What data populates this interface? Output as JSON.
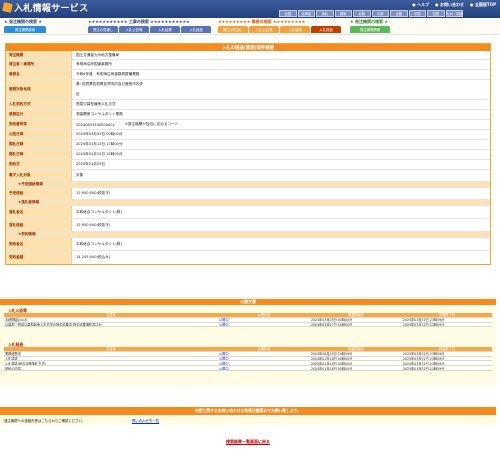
{
  "header": {
    "title": "入札情報サービス",
    "links": [
      "ヘルプ",
      "お問い合わせ",
      "全国版TOP"
    ],
    "regions": [
      "全国",
      "北海道",
      "東北",
      "関東",
      "北陸",
      "中部",
      "近畿",
      "中国",
      "四国",
      "九州・沖縄"
    ],
    "brand_color": "#2c4a8a",
    "accent_color": "#f58a1f"
  },
  "nav": {
    "groups": [
      {
        "head": "★ 発注機関の検索 ★",
        "head_color": "#2c4a8a",
        "tab_color": "#2c8fd6",
        "tabs": [
          "発注機関検索"
        ]
      },
      {
        "head": "★★★★★★★★★★★ 工事の検索 ★★★★★★★★★★★",
        "head_color": "#2c4a8a",
        "tab_color": "#5a73b8",
        "tabs": [
          "発注の見通し",
          "入札公告等",
          "入札結果",
          "入札経過"
        ]
      },
      {
        "head": "★★★★★★★★★ 業務の検索 ★★★★★★★★★",
        "head_color": "#e06000",
        "tab_color": "#f2a03c",
        "tabs": [
          "発注の見通し",
          "入札公告等",
          "入札結果",
          "入札経過"
        ]
      },
      {
        "head": "★ 発注機関の検索 ★",
        "head_color": "#2e8b2e",
        "tab_color": "#5cb85c",
        "tabs": [
          "発注機関情報"
        ]
      }
    ]
  },
  "main": {
    "title": "入札の経過(業務)案件概要",
    "rows": [
      {
        "label": "発注機関",
        "value": "国土交通省九州地方整備局"
      },
      {
        "label": "発注者・事務所",
        "value": "有明海沿岸国道事務所"
      },
      {
        "label": "業務名",
        "value": "令和6年度　有明海沿岸道路再整備業務"
      },
      {
        "label": "業務対象地域",
        "value": "県: 佐賀県佐賀県佐賀市内及び鹿島市内外",
        "value2": "区"
      },
      {
        "label": "入札契約方式",
        "value": "簡易公募型競争入札方式"
      },
      {
        "label": "業務区分",
        "value": "測量関係コンサルタント業務"
      },
      {
        "label": "契約番号等",
        "value": "20240801330200002",
        "note": "※発注機関が独自に定めるコード"
      },
      {
        "label": "公告日時",
        "value": "2024年03月05日 00時00分"
      },
      {
        "label": "開札日時",
        "value": "2024年01月15日 17時00分"
      },
      {
        "label": "開札日時",
        "value": "2024年01月15日 10時00分"
      },
      {
        "label": "契約日",
        "value": "2024年01月25日"
      },
      {
        "label": "電子入札対象",
        "value": "対象"
      }
    ],
    "sections": {
      "plan_title": "★予定価格情報",
      "winner_title": "★落札者情報",
      "contract_title": "★契約情報"
    },
    "planned_price": {
      "label": "予定価格",
      "value": "12,950,000(税抜き)"
    },
    "winner": [
      {
        "label": "落札者名",
        "value": "平和総合コンサルタント(株)"
      },
      {
        "label": "落札価格",
        "value": "12,950,000(税抜き)"
      }
    ],
    "contract": [
      {
        "label": "契約者名",
        "value": "平和総合コンサルタント(株)"
      },
      {
        "label": "契約金額",
        "value": "14,245,000(税込み)"
      }
    ]
  },
  "docs": {
    "title": "公開文書",
    "section1": {
      "title": "入札公告等",
      "headers": [
        "文書名",
        "公開状況",
        "掲載開始日",
        "掲載終了日"
      ],
      "rows": [
        [
          "手続開始の公示",
          "公開中",
          "2024年03月05日 00時00分",
          "2025年03月31日 23時59分"
        ],
        [
          "公募型・簡易公募型競争入札方式の指名結果書 指名結果通知書ほか",
          "公開中",
          "2024年03月27日 00時00分",
          "2025年03月31日 23時59分"
        ]
      ]
    },
    "section2": {
      "title": "入札経過",
      "headers": [
        "文書名",
        "公開状況",
        "掲載開始日",
        "掲載終了日"
      ],
      "rows": [
        [
          "業務経歴書",
          "公開中",
          "2024年06月25日 19時59分",
          "2025年03月31日 23時59分"
        ],
        [
          "入札調書",
          "公開中",
          "2024年01月18日 00時00分",
          "2025年03月31日 23時59分"
        ],
        [
          "入札調書(総合評価落札方式)",
          "公開中",
          "2024年01月18日 00時00分",
          "2025年03月31日 23時59分"
        ],
        [
          "契約の内容",
          "公開中",
          "2024年01月18日 00時00分",
          "2025年03月31日 23時59分"
        ]
      ]
    }
  },
  "footer": {
    "notice": "内容に関するお問い合わせは各発注機関までお願い致します。",
    "contact_text": "発注機関への連絡先等はこちらからご確認ください。",
    "contact_link": "問い合わせ先一覧",
    "back_link": "検索結果一覧画面に戻る"
  }
}
